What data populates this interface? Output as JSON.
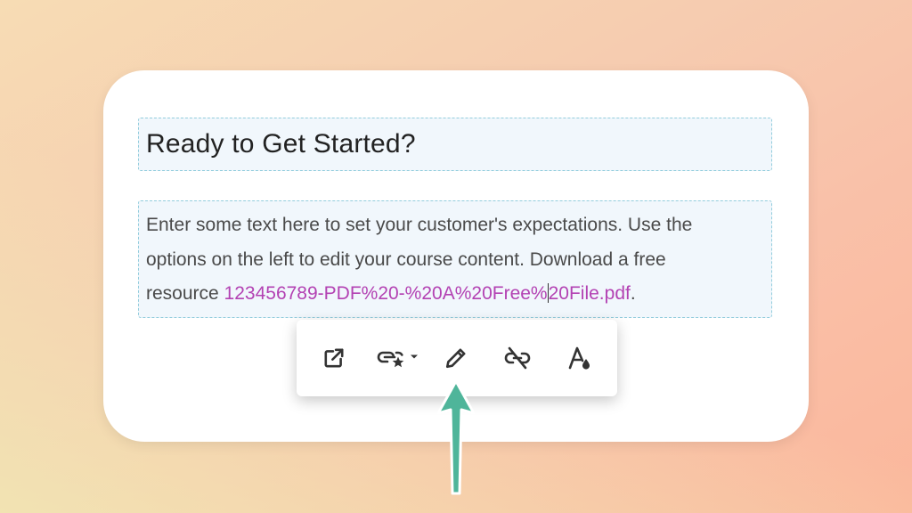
{
  "editor": {
    "heading": "Ready to Get Started?",
    "body_line_1": "Enter some text here to set your customer's expectations. Use the",
    "body_line_2": "options on the left to edit your course content. Download a free",
    "body_line_3_prefix": "resource ",
    "link_part_1": "123456789-PDF%20-%20A%20Free%",
    "link_part_2": "20File.pdf",
    "body_suffix": "."
  },
  "link_toolbar": {
    "buttons": [
      {
        "icon": "open-in-new-tab-icon"
      },
      {
        "icon": "link-style-dropdown-icon"
      },
      {
        "icon": "pencil-edit-icon"
      },
      {
        "icon": "unlink-icon"
      },
      {
        "icon": "text-color-icon"
      }
    ]
  },
  "colors": {
    "link": "#b342b3",
    "block_border": "#93cddd",
    "block_bg": "#f1f7fc",
    "pointer_arrow": "#4fb59a"
  }
}
